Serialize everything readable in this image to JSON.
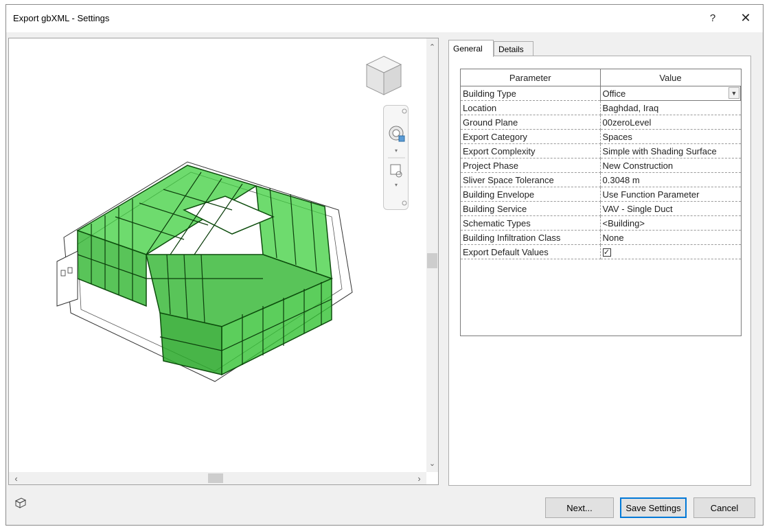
{
  "window": {
    "title": "Export gbXML - Settings",
    "help_label": "?",
    "close_label": "✕"
  },
  "tabs": [
    {
      "label": "General",
      "active": true
    },
    {
      "label": "Details",
      "active": false
    }
  ],
  "grid": {
    "headers": {
      "parameter": "Parameter",
      "value": "Value"
    },
    "rows": [
      {
        "parameter": "Building Type",
        "value": "Office"
      },
      {
        "parameter": "Location",
        "value": "Baghdad, Iraq"
      },
      {
        "parameter": "Ground Plane",
        "value": "00zeroLevel"
      },
      {
        "parameter": "Export Category",
        "value": "Spaces"
      },
      {
        "parameter": "Export Complexity",
        "value": "Simple with Shading Surface"
      },
      {
        "parameter": "Project Phase",
        "value": "New Construction"
      },
      {
        "parameter": "Sliver Space Tolerance",
        "value": "0.3048 m"
      },
      {
        "parameter": "Building Envelope",
        "value": "Use Function Parameter"
      },
      {
        "parameter": "Building Service",
        "value": "VAV - Single Duct"
      },
      {
        "parameter": "Schematic Types",
        "value": "<Building>"
      },
      {
        "parameter": "Building Infiltration Class",
        "value": "None"
      },
      {
        "parameter": "Export Default Values",
        "checked": true
      }
    ]
  },
  "buttons": {
    "next": "Next...",
    "save": "Save Settings",
    "cancel": "Cancel"
  },
  "icons": {
    "viewcube": "viewcube-icon",
    "steering_wheel": "steering-wheel-icon",
    "zoom": "zoom-region-icon",
    "view_3d": "3d-view-icon"
  },
  "colors": {
    "model_fill": "#33cc33",
    "accent": "#0078d7"
  }
}
